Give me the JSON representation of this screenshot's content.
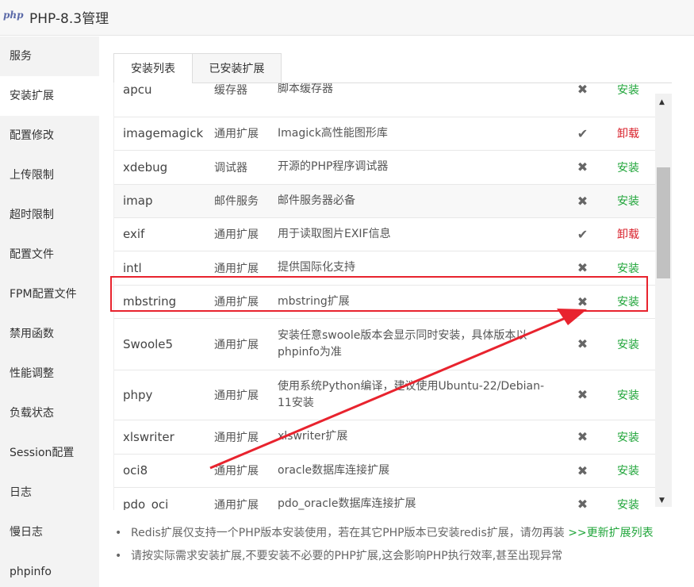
{
  "window": {
    "logo_text": "php",
    "title": "PHP-8.3管理"
  },
  "sidebar": {
    "items": [
      {
        "label": "服务"
      },
      {
        "label": "安装扩展"
      },
      {
        "label": "配置修改"
      },
      {
        "label": "上传限制"
      },
      {
        "label": "超时限制"
      },
      {
        "label": "配置文件"
      },
      {
        "label": "FPM配置文件"
      },
      {
        "label": "禁用函数"
      },
      {
        "label": "性能调整"
      },
      {
        "label": "负载状态"
      },
      {
        "label": "Session配置"
      },
      {
        "label": "日志"
      },
      {
        "label": "慢日志"
      },
      {
        "label": "phpinfo"
      }
    ],
    "active_index": 1
  },
  "tabs": [
    {
      "label": "安装列表"
    },
    {
      "label": "已安装扩展"
    }
  ],
  "extensions": [
    {
      "name": "apcu",
      "type": "缓存器",
      "desc": "脚本缓存器",
      "status": "✖",
      "action": "安装"
    },
    {
      "name": "imagemagick",
      "type": "通用扩展",
      "desc": "Imagick高性能图形库",
      "status": "✔",
      "action": "卸载"
    },
    {
      "name": "xdebug",
      "type": "调试器",
      "desc": "开源的PHP程序调试器",
      "status": "✖",
      "action": "安装"
    },
    {
      "name": "imap",
      "type": "邮件服务",
      "desc": "邮件服务器必备",
      "status": "✖",
      "action": "安装"
    },
    {
      "name": "exif",
      "type": "通用扩展",
      "desc": "用于读取图片EXIF信息",
      "status": "✔",
      "action": "卸载"
    },
    {
      "name": "intl",
      "type": "通用扩展",
      "desc": "提供国际化支持",
      "status": "✖",
      "action": "安装"
    },
    {
      "name": "mbstring",
      "type": "通用扩展",
      "desc": "mbstring扩展",
      "status": "✖",
      "action": "安装"
    },
    {
      "name": "Swoole5",
      "type": "通用扩展",
      "desc": "安装任意swoole版本会显示同时安装，具体版本以phpinfo为准",
      "status": "✖",
      "action": "安装"
    },
    {
      "name": "phpy",
      "type": "通用扩展",
      "desc": "使用系统Python编译，建议使用Ubuntu-22/Debian-11安装",
      "status": "✖",
      "action": "安装"
    },
    {
      "name": "xlswriter",
      "type": "通用扩展",
      "desc": "xlswriter扩展",
      "status": "✖",
      "action": "安装"
    },
    {
      "name": "oci8",
      "type": "通用扩展",
      "desc": "oracle数据库连接扩展",
      "status": "✖",
      "action": "安装"
    },
    {
      "name": "pdo_oci",
      "type": "通用扩展",
      "desc": "pdo_oracle数据库连接扩展",
      "status": "✖",
      "action": "安装"
    }
  ],
  "notes": {
    "note1_text": "Redis扩展仅支持一个PHP版本安装使用，若在其它PHP版本已安装redis扩展，请勿再装",
    "note1_link": ">>更新扩展列表",
    "note2_text": "请按实际需求安装扩展,不要安装不必要的PHP扩展,这会影响PHP执行效率,甚至出现异常"
  },
  "colors": {
    "install": "#20a53a",
    "uninstall": "#d9232d",
    "annotation": "#e8232e"
  },
  "icons": {
    "scroll_up": "▲",
    "scroll_down": "▼",
    "bullet": "•"
  }
}
